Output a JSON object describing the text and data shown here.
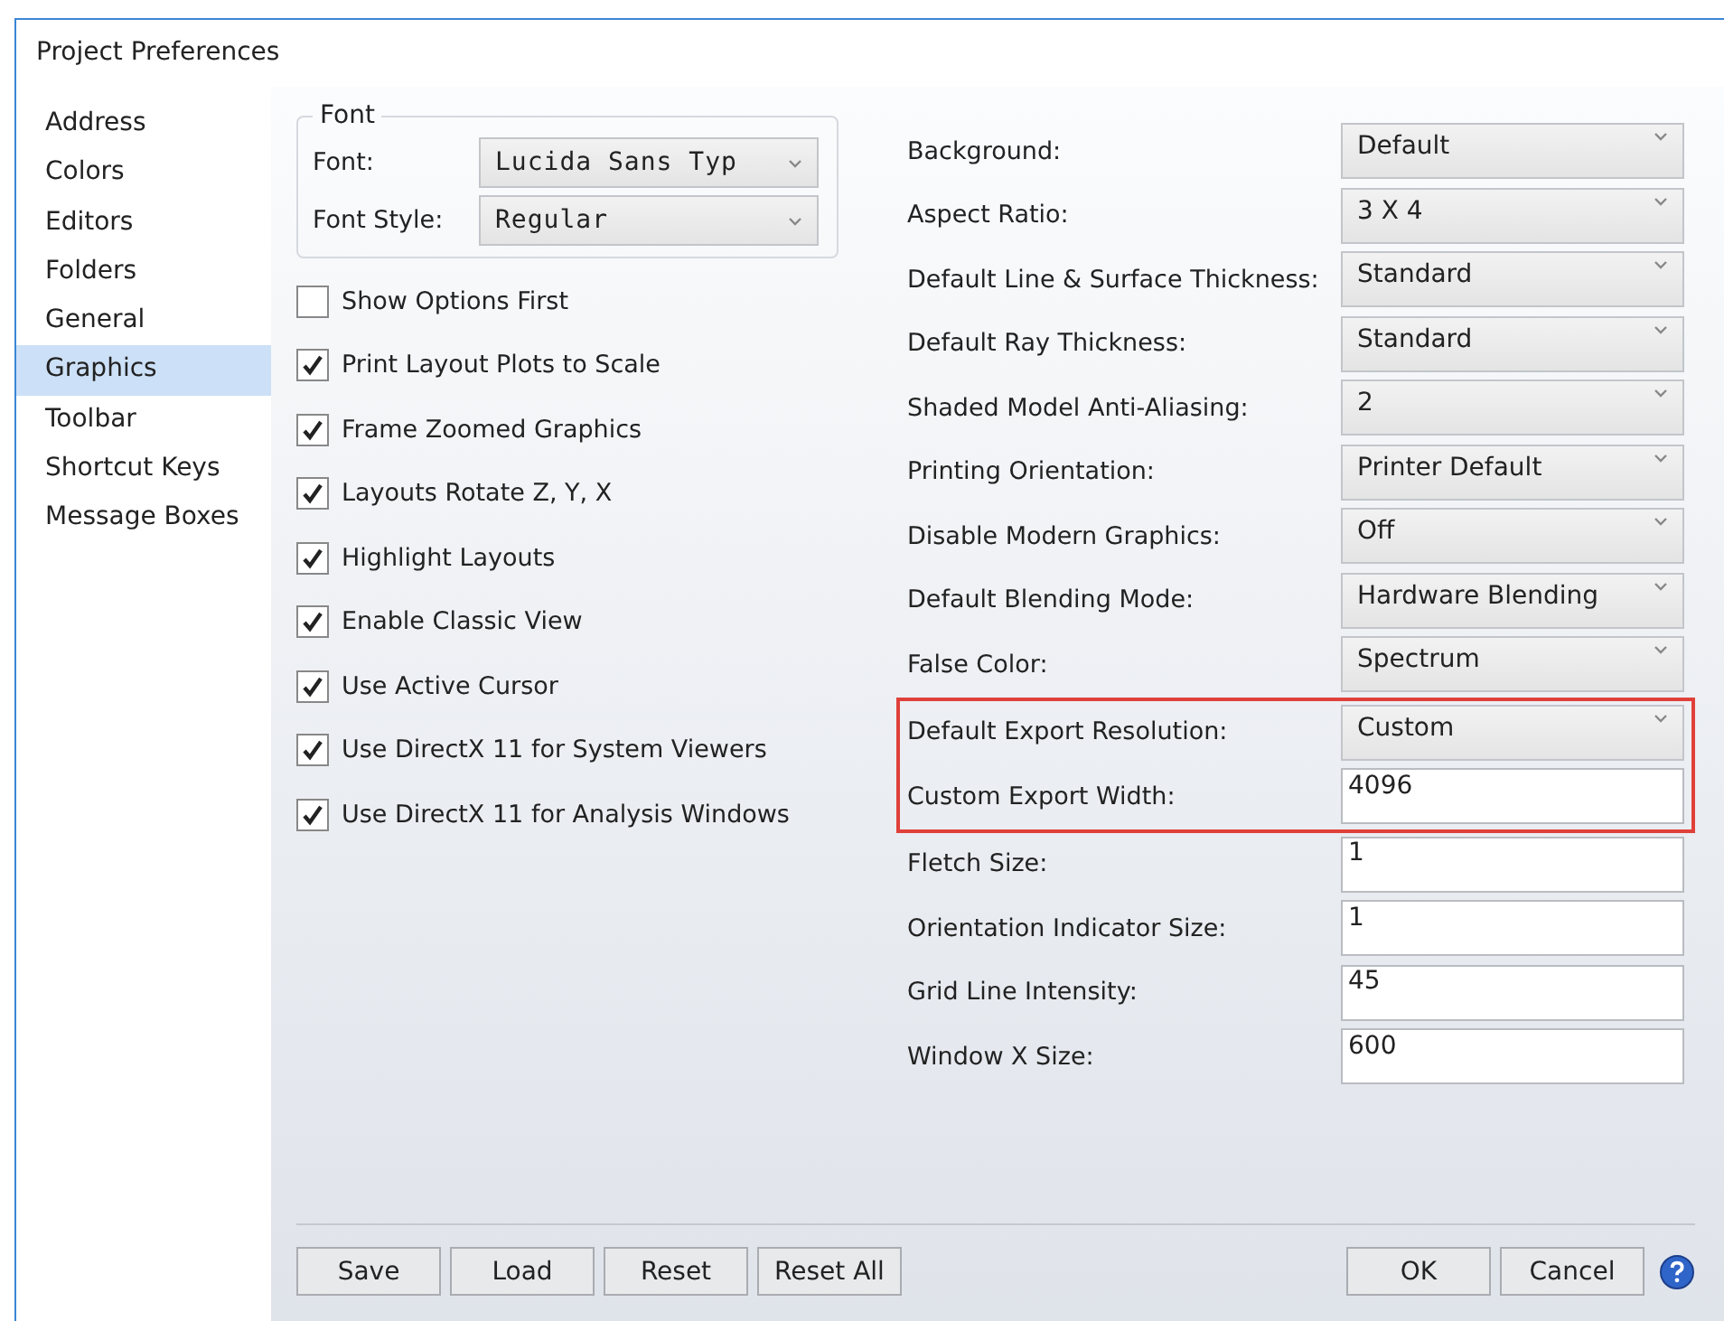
{
  "window": {
    "title": "Project Preferences"
  },
  "sidebar": {
    "items": [
      {
        "label": "Address",
        "selected": false
      },
      {
        "label": "Colors",
        "selected": false
      },
      {
        "label": "Editors",
        "selected": false
      },
      {
        "label": "Folders",
        "selected": false
      },
      {
        "label": "General",
        "selected": false
      },
      {
        "label": "Graphics",
        "selected": true
      },
      {
        "label": "Toolbar",
        "selected": false
      },
      {
        "label": "Shortcut Keys",
        "selected": false
      },
      {
        "label": "Message Boxes",
        "selected": false
      }
    ]
  },
  "font_group": {
    "title": "Font",
    "rows": [
      {
        "label": "Font:",
        "value": "Lucida Sans Typ"
      },
      {
        "label": "Font Style:",
        "value": "Regular"
      }
    ]
  },
  "options": [
    {
      "label": "Show Options First",
      "checked": false
    },
    {
      "label": "Print Layout Plots to Scale",
      "checked": true
    },
    {
      "label": "Frame Zoomed Graphics",
      "checked": true
    },
    {
      "label": "Layouts Rotate Z, Y, X",
      "checked": true
    },
    {
      "label": "Highlight Layouts",
      "checked": true
    },
    {
      "label": "Enable Classic View",
      "checked": true
    },
    {
      "label": "Use Active Cursor",
      "checked": true
    },
    {
      "label": "Use DirectX 11 for System Viewers",
      "checked": true
    },
    {
      "label": "Use DirectX 11 for Analysis Windows",
      "checked": true
    }
  ],
  "settings": [
    {
      "label": "Background:",
      "kind": "dropdown",
      "value": "Default",
      "highlighted": false
    },
    {
      "label": "Aspect Ratio:",
      "kind": "dropdown",
      "value": "3 X 4",
      "highlighted": false
    },
    {
      "label": "Default Line & Surface Thickness:",
      "kind": "dropdown",
      "value": "Standard",
      "highlighted": false
    },
    {
      "label": "Default Ray Thickness:",
      "kind": "dropdown",
      "value": "Standard",
      "highlighted": false
    },
    {
      "label": "Shaded Model Anti-Aliasing:",
      "kind": "dropdown",
      "value": "2",
      "highlighted": false
    },
    {
      "label": "Printing Orientation:",
      "kind": "dropdown",
      "value": "Printer Default",
      "highlighted": false
    },
    {
      "label": "Disable Modern Graphics:",
      "kind": "dropdown",
      "value": "Off",
      "highlighted": false
    },
    {
      "label": "Default Blending Mode:",
      "kind": "dropdown",
      "value": "Hardware Blending",
      "highlighted": false
    },
    {
      "label": "False Color:",
      "kind": "dropdown",
      "value": "Spectrum",
      "highlighted": false
    },
    {
      "label": "Default Export Resolution:",
      "kind": "dropdown",
      "value": "Custom",
      "highlighted": true
    },
    {
      "label": "Custom Export Width:",
      "kind": "field",
      "value": "4096",
      "highlighted": true
    },
    {
      "label": "Fletch Size:",
      "kind": "field",
      "value": "1",
      "highlighted": false
    },
    {
      "label": "Orientation Indicator Size:",
      "kind": "field",
      "value": "1",
      "highlighted": false
    },
    {
      "label": "Grid Line Intensity:",
      "kind": "field",
      "value": "45",
      "highlighted": false
    },
    {
      "label": "Window X Size:",
      "kind": "field",
      "value": "600",
      "highlighted": false
    }
  ],
  "buttons_left": [
    "Save",
    "Load",
    "Reset",
    "Reset All"
  ],
  "buttons_right": [
    "OK",
    "Cancel"
  ]
}
